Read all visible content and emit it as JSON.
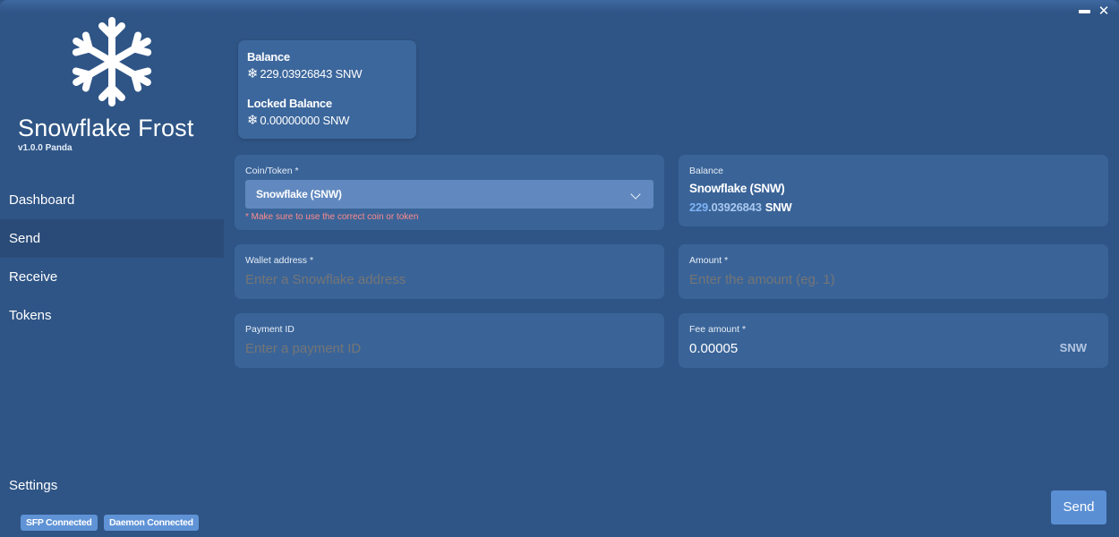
{
  "app": {
    "title": "Snowflake Frost",
    "version": "v1.0.0 Panda"
  },
  "window_controls": {
    "minimize_icon": "minimize-icon",
    "close_icon": "close-icon"
  },
  "sidebar": {
    "items": [
      {
        "label": "Dashboard",
        "active": false
      },
      {
        "label": "Send",
        "active": true
      },
      {
        "label": "Receive",
        "active": false
      },
      {
        "label": "Tokens",
        "active": false
      }
    ],
    "settings_label": "Settings",
    "status_badges": [
      "SFP Connected",
      "Daemon Connected"
    ]
  },
  "balance_card": {
    "balance_label": "Balance",
    "balance_value": "229.03926843 SNW",
    "locked_label": "Locked Balance",
    "locked_value": "0.00000000 SNW",
    "icon": "snowflake-icon"
  },
  "form": {
    "coin": {
      "label": "Coin/Token *",
      "selected": "Snowflake (SNW)",
      "hint": "* Make sure to use the correct coin or token"
    },
    "balance": {
      "label": "Balance",
      "name": "Snowflake (SNW)",
      "amount_int": "229",
      "amount_dec": ".03926843",
      "unit": "SNW"
    },
    "wallet": {
      "label": "Wallet address *",
      "placeholder": "Enter a Snowflake address"
    },
    "amount": {
      "label": "Amount *",
      "placeholder": "Enter the amount (eg. 1)"
    },
    "payment_id": {
      "label": "Payment ID",
      "placeholder": "Enter a payment ID"
    },
    "fee": {
      "label": "Fee amount *",
      "value": "0.00005",
      "unit": "SNW"
    }
  },
  "actions": {
    "send_label": "Send"
  },
  "colors": {
    "background": "#2f5586",
    "card": "#3a6498",
    "select": "#6189bf",
    "accent_button": "#5b8fd4",
    "hint_red": "#ff8b8b",
    "balance_blue": "#7fb2f5"
  }
}
